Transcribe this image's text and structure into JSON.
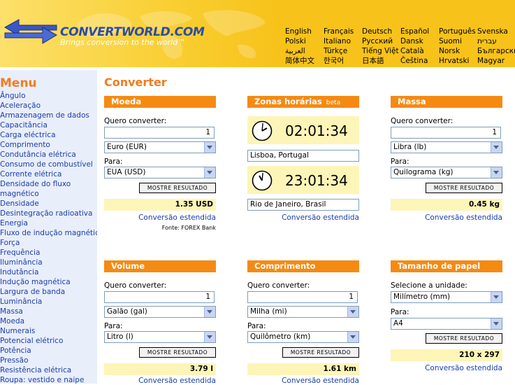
{
  "header": {
    "logo_name": "CONVERTWORLD.COM",
    "logo_tagline": "Brings conversion to the world™",
    "languages": [
      [
        "English",
        "Polski",
        "العربية",
        "简体中文"
      ],
      [
        "Français",
        "Italiano",
        "Türkçe",
        "한국어"
      ],
      [
        "Deutsch",
        "Русский",
        "Tiếng Việt",
        "日本語"
      ],
      [
        "Español",
        "Dansk",
        "Català",
        "Čeština"
      ],
      [
        "Português",
        "Suomi",
        "Norsk",
        "Hrvatski"
      ],
      [
        "Svenska",
        "עברית",
        "Български",
        "Magyar"
      ]
    ]
  },
  "sidebar": {
    "title": "Menu",
    "items": [
      "Ângulo",
      "Aceleração",
      "Armazenagem de dados",
      "Capacitância",
      "Carga eléctrica",
      "Comprimento",
      "Condutância elétrica",
      "Consumo de combustível",
      "Corrente elétrica",
      "Densidade do fluxo",
      "magnético",
      "Densidade",
      "Desintegração radioativa",
      "Energia",
      "Fluxo de indução magnética",
      "Força",
      "Frequência",
      "Iluminância",
      "Indutância",
      "Indução magnética",
      "Largura de banda",
      "Luminância",
      "Massa",
      "Moeda",
      "Numerais",
      "Potencial elétrico",
      "Potência",
      "Pressão",
      "Resistência elétrica",
      "Roupa: vestido e naipe"
    ]
  },
  "page_title": "Converter",
  "common": {
    "want_label": "Quero converter:",
    "to_label": "Para:",
    "button_label": "MOSTRE RESULTADO",
    "extended_link": "Conversão estendida"
  },
  "moeda": {
    "title": "Moeda",
    "amount": "1",
    "from": "Euro (EUR)",
    "to": "EUA (USD)",
    "result": "1.35 USD",
    "source": "Fonte: FOREX Bank"
  },
  "zonas": {
    "title": "Zonas horárias",
    "beta": "beta",
    "clocks": [
      {
        "time": "02:01:34",
        "place": "Lisboa, Portugal",
        "hour": 2,
        "minute": 1
      },
      {
        "time": "23:01:34",
        "place": "Rio de Janeiro, Brasil",
        "hour": 23,
        "minute": 1
      }
    ]
  },
  "massa": {
    "title": "Massa",
    "amount": "1",
    "from": "Libra (lb)",
    "to": "Quilograma (kg)",
    "result": "0.45 kg"
  },
  "volume": {
    "title": "Volume",
    "amount": "1",
    "from": "Galão (gal)",
    "to": "Litro (l)",
    "result": "3.79 l"
  },
  "comprimento": {
    "title": "Comprimento",
    "amount": "1",
    "from": "Milha (mi)",
    "to": "Quilômetro (km)",
    "result": "1.61 km"
  },
  "papel": {
    "title": "Tamanho de papel",
    "unit_label": "Selecione a unidade:",
    "unit": "Milímetro (mm)",
    "to": "A4",
    "result": "210 x 297"
  },
  "colors": {
    "header_yellow": "#f7c21a",
    "box_header_orange": "#f58a13",
    "title_orange": "#f47b20",
    "link_blue": "#1b3ea8",
    "sidebar_bg": "#e9eefb",
    "result_bg": "#fdf5b8"
  }
}
